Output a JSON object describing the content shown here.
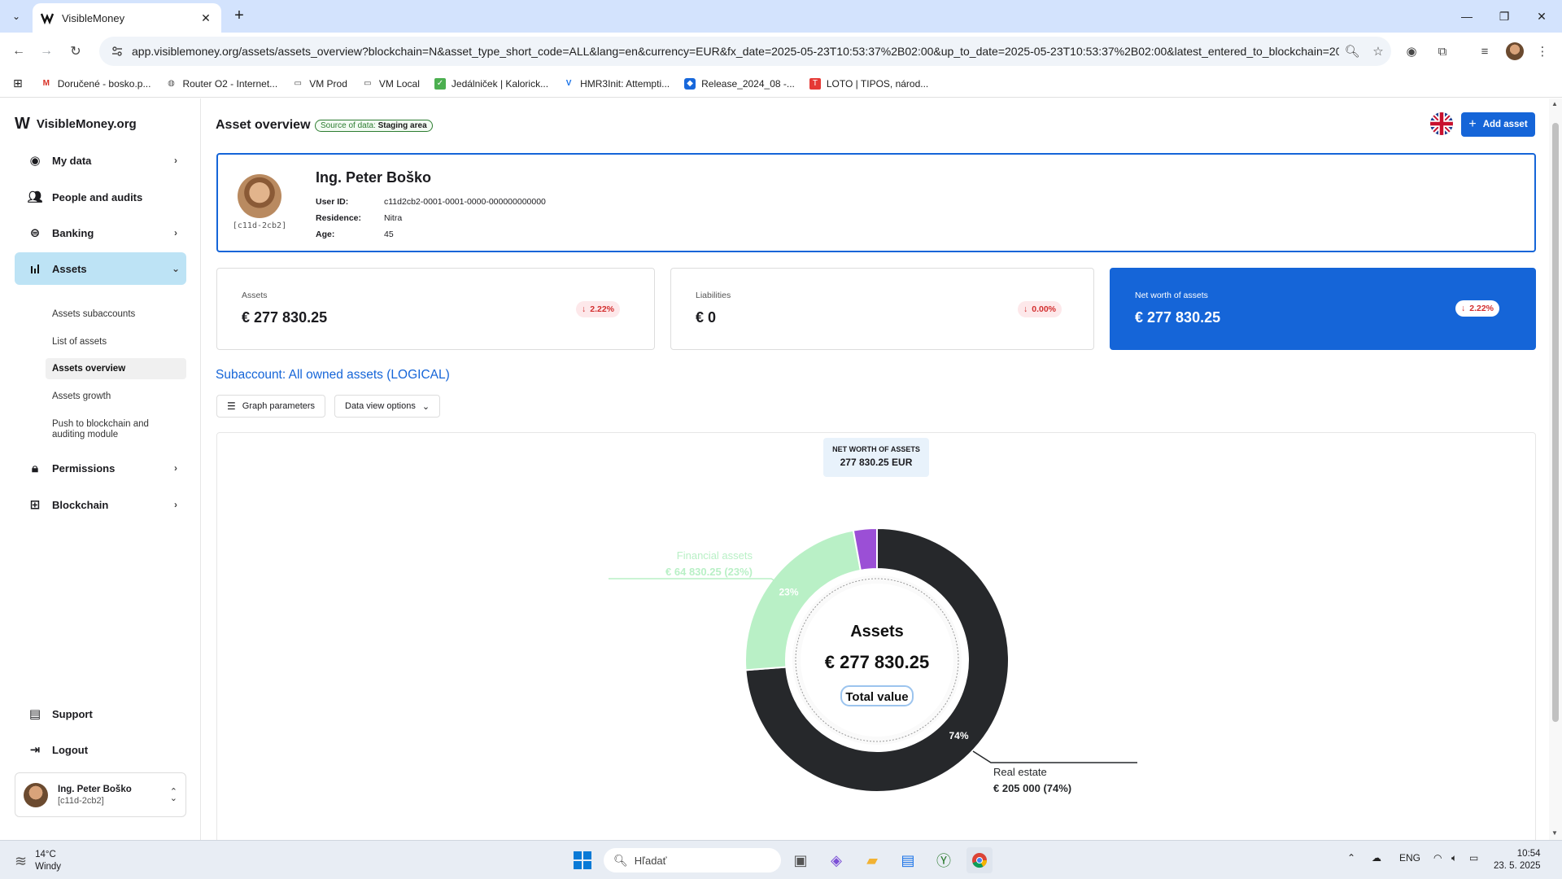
{
  "browser": {
    "tab_title": "VisibleMoney",
    "url": "app.visiblemoney.org/assets/assets_overview?blockchain=N&asset_type_short_code=ALL&lang=en&currency=EUR&fx_date=2025-05-23T10:53:37%2B02:00&up_to_date=2025-05-23T10:53:37%2B02:00&latest_entered_to_blockchain=20...",
    "bookmarks": [
      {
        "label": "Doručené - bosko.p...",
        "icon": "gmail-icon"
      },
      {
        "label": "Router O2 - Internet...",
        "icon": "globe-icon"
      },
      {
        "label": "VM Prod",
        "icon": "folder-icon"
      },
      {
        "label": "VM Local",
        "icon": "folder-icon"
      },
      {
        "label": "Jedálniček | Kalorick...",
        "icon": "checklist-icon"
      },
      {
        "label": "HMR3Init: Attempti...",
        "icon": "virtualbox-icon"
      },
      {
        "label": "Release_2024_08 -...",
        "icon": "jira-icon"
      },
      {
        "label": "LOTO | TIPOS, národ...",
        "icon": "tipos-icon"
      }
    ]
  },
  "sidebar": {
    "brand": "VisibleMoney.org",
    "items": [
      {
        "label": "My data",
        "icon": "user-circle-icon"
      },
      {
        "label": "People and audits",
        "icon": "people-icon"
      },
      {
        "label": "Banking",
        "icon": "banking-icon"
      },
      {
        "label": "Assets",
        "icon": "bar-chart-icon"
      },
      {
        "label": "Permissions",
        "icon": "lock-icon"
      },
      {
        "label": "Blockchain",
        "icon": "grid-icon"
      }
    ],
    "asset_subitems": [
      "Assets subaccounts",
      "List of assets",
      "Assets overview",
      "Assets growth",
      "Push to blockchain and auditing module"
    ],
    "support": "Support",
    "logout": "Logout",
    "user": {
      "name": "Ing. Peter Boško",
      "id": "[c11d-2cb2]"
    }
  },
  "header": {
    "title": "Asset overview",
    "source_label": "Source of data:",
    "source_value": "Staging area",
    "add_asset": "Add asset"
  },
  "profile": {
    "name": "Ing. Peter Boško",
    "short_id": "[c11d-2cb2]",
    "user_id_label": "User ID:",
    "user_id": "c11d2cb2-0001-0001-0000-000000000000",
    "residence_label": "Residence:",
    "residence": "Nitra",
    "age_label": "Age:",
    "age": "45"
  },
  "kpis": {
    "assets": {
      "label": "Assets",
      "value": "€ 277 830.25",
      "delta": "2.22%"
    },
    "liabilities": {
      "label": "Liabilities",
      "value": "€ 0",
      "delta": "0.00%"
    },
    "net_worth": {
      "label": "Net worth of assets",
      "value": "€ 277 830.25",
      "delta": "2.22%"
    }
  },
  "subaccount_title": "Subaccount: All owned assets (LOGICAL)",
  "buttons": {
    "graph_parameters": "Graph parameters",
    "data_view_options": "Data view options"
  },
  "net_worth_box": {
    "label": "NET WORTH OF ASSETS",
    "value": "277 830.25 EUR"
  },
  "chart_data": {
    "type": "pie",
    "center_title": "Assets",
    "center_value": "€ 277 830.25",
    "center_caption": "Total value",
    "slices": [
      {
        "name": "Real estate",
        "value": 205000,
        "value_label": "€ 205 000 (74%)",
        "pct_label": "74%",
        "color": "#26282b"
      },
      {
        "name": "Financial assets",
        "value": 64830.25,
        "value_label": "€ 64 830.25 (23%)",
        "pct_label": "23%",
        "color": "#b9f0c6"
      },
      {
        "name": "",
        "value": 8000,
        "value_label": "",
        "pct_label": "",
        "color": "#9b4fd6"
      }
    ]
  },
  "taskbar": {
    "temperature": "14°C",
    "weather": "Windy",
    "search_placeholder": "Hľadať",
    "language": "ENG",
    "time": "10:54",
    "date": "23. 5. 2025"
  },
  "colors": {
    "accent": "#1565d8",
    "active_nav": "#bde3f5",
    "negative": "#d32f2f"
  }
}
